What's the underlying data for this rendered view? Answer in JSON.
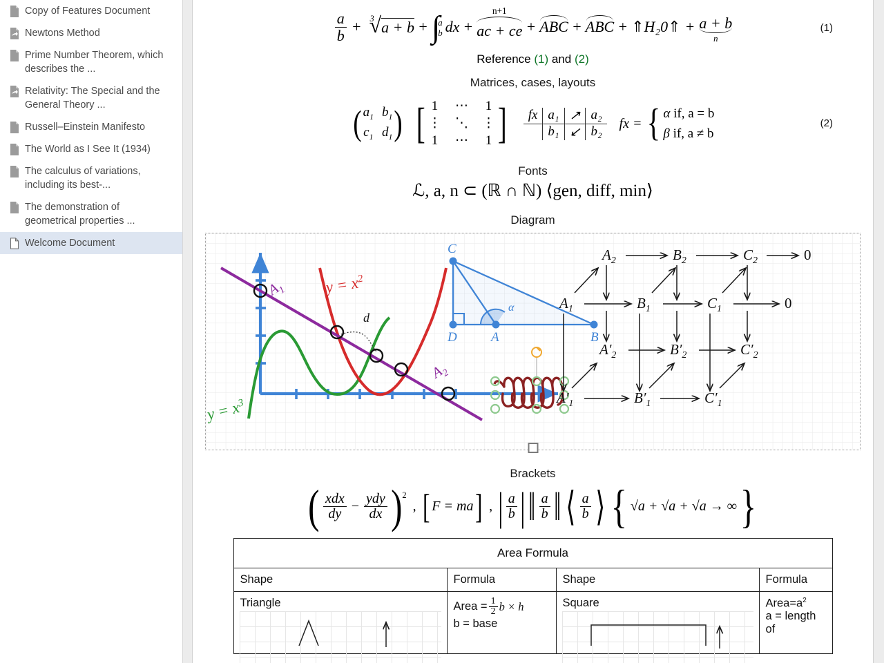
{
  "sidebar": {
    "items": [
      {
        "label": "Copy of Features Document",
        "icon": "document-icon",
        "selected": false
      },
      {
        "label": "Newtons Method",
        "icon": "document-shortcut-icon",
        "selected": false
      },
      {
        "label": "Prime Number Theorem, which describes the ...",
        "icon": "document-icon",
        "selected": false
      },
      {
        "label": "Relativity: The Special and the General Theory ...",
        "icon": "document-shortcut-icon",
        "selected": false
      },
      {
        "label": "Russell–Einstein Manifesto",
        "icon": "document-icon",
        "selected": false
      },
      {
        "label": "The World as I See It (1934)",
        "icon": "document-icon",
        "selected": false
      },
      {
        "label": "The calculus of variations, including its best-...",
        "icon": "document-icon",
        "selected": false
      },
      {
        "label": "The demonstration of geometrical properties ...",
        "icon": "document-icon",
        "selected": false
      },
      {
        "label": "Welcome Document",
        "icon": "document-outline-icon",
        "selected": true
      }
    ],
    "selected_highlight": "#dde5f1"
  },
  "document": {
    "equation1": {
      "number": "(1)",
      "parts": {
        "frac_a_b_num": "a",
        "frac_a_b_den": "b",
        "plus": "+",
        "cbrt_index": "3",
        "cbrt_body": "a + b",
        "int_upper": "a",
        "int_lower": "b",
        "int_body": "dx",
        "overbrace_label": "n+1",
        "overbrace_body": "ac + ce",
        "widehat1": "ABC",
        "widehat2": "ABC",
        "updelim": "⇑",
        "h2o": "H₂0",
        "underbrace_body": "a + b",
        "underbrace_label": "n"
      }
    },
    "reference_line": {
      "prefix": "Reference",
      "ref1": "(1)",
      "mid": "and",
      "ref2": "(2)",
      "ref_color": "#11772a"
    },
    "headings": {
      "matrices": "Matrices, cases, layouts",
      "fonts": "Fonts",
      "diagram": "Diagram",
      "brackets": "Brackets"
    },
    "equation2": {
      "number": "(2)",
      "pmatrix": [
        [
          "a",
          "1",
          "b",
          "1"
        ],
        [
          "c",
          "1",
          "d",
          "1"
        ]
      ],
      "bmatrix": [
        [
          "1",
          "⋯",
          "1"
        ],
        [
          "⋮",
          "⋱",
          "⋮"
        ],
        [
          "1",
          "⋯",
          "1"
        ]
      ],
      "fxtable": {
        "corner": "fx",
        "row1": [
          "a₁",
          "↗",
          "a₂"
        ],
        "row2": [
          "b₁",
          "↙",
          "b₂"
        ]
      },
      "cases": {
        "lhs": "fx =",
        "row1": {
          "value": "α",
          "cond": "if,  a = b"
        },
        "row2": {
          "value": "β",
          "cond": "if,  a ≠ b"
        }
      }
    },
    "fonts_line": "ℒ, a, n ⊂ (ℝ ∩ ℕ)  ⟨gen, diff, min⟩",
    "brackets_line": {
      "p1_num1": "xdx",
      "p1_den1": "dy",
      "p1_minus": "−",
      "p1_num2": "ydy",
      "p1_den2": "dx",
      "p1_pow": "2",
      "p2": "F = ma",
      "p3_num": "a",
      "p3_den": "b",
      "p4": "√a + √a + √a → ∞"
    },
    "area_table": {
      "title": "Area Formula",
      "headers": [
        "Shape",
        "Formula",
        "Shape",
        "Formula"
      ],
      "rows": [
        {
          "shape1": "Triangle",
          "formula1_lead": "Area =",
          "formula1_fracnum": "1",
          "formula1_fracden": "2",
          "formula1_tail": "b × h",
          "formula1_line2": "b = base",
          "shape2": "Square",
          "formula2": "Area=a",
          "formula2_sup": "2",
          "formula2_line2": "a = length of"
        }
      ]
    }
  },
  "diagram": {
    "canvas_handle": "resize-handle",
    "graph": {
      "curve_labels": [
        {
          "text": "y = x",
          "sup": "2",
          "color": "#d62b2b",
          "name": "parabola-label"
        },
        {
          "text": "y = x",
          "sup": "3",
          "color": "#2a9a34",
          "name": "cubic-label"
        }
      ],
      "line_labels": [
        {
          "text": "A",
          "sub": "1",
          "color": "#8d2a9e"
        },
        {
          "text": "A",
          "sub": "2",
          "color": "#8d2a9e"
        }
      ],
      "distance_label": "d",
      "axis_color": "#3f84d6",
      "intersection_markers": 5
    },
    "triangle": {
      "vertices": [
        "C",
        "D",
        "A",
        "B"
      ],
      "angle_label": "α",
      "color": "#3f84d6"
    },
    "coil": {
      "name": "coil-shape",
      "color": "#8b2222",
      "selected": true,
      "rotation_handle_color": "#f0a830",
      "handle_color": "#8ec98e"
    },
    "commutative": {
      "rows": [
        [
          "A₂",
          "B₂",
          "C₂",
          "0"
        ],
        [
          "A₁",
          "B₁",
          "C₁",
          "0"
        ],
        [
          "A′₂",
          "B′₂",
          "C′₂"
        ],
        [
          "A′₁",
          "B′₁",
          "C′₁"
        ]
      ]
    }
  }
}
